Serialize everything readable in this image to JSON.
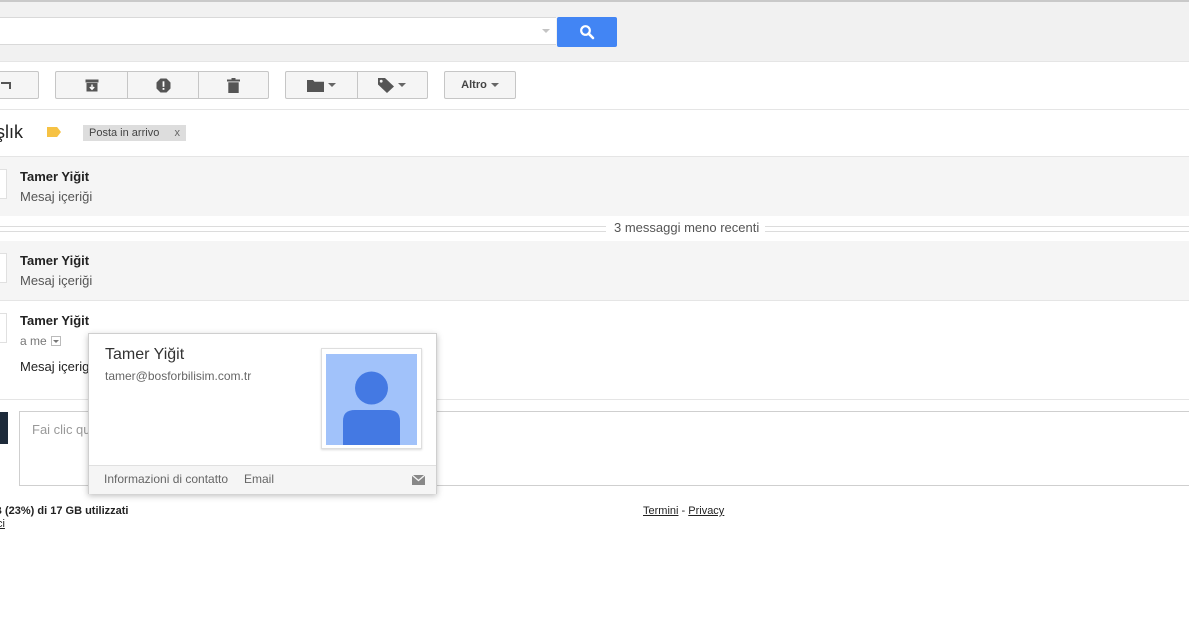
{
  "search": {
    "placeholder": "",
    "value": ""
  },
  "toolbar": {
    "archive_icon": "archive-icon",
    "spam_icon": "report-spam-icon",
    "delete_icon": "trash-icon",
    "move_icon": "folder-icon",
    "labels_icon": "label-tag-icon",
    "more_label": "Altro"
  },
  "thread": {
    "subject": "şlık",
    "inbox_label": "Posta in arrivo",
    "inbox_remove": "x",
    "older_messages": "3 messaggi meno recenti"
  },
  "messages": [
    {
      "sender": "Tamer Yiğit",
      "snippet": "Mesaj içeriği"
    },
    {
      "sender": "Tamer Yiğit",
      "snippet": "Mesaj içeriği"
    },
    {
      "sender": "Tamer Yiğit",
      "recipient": "a me",
      "body": "Mesaj içerig"
    }
  ],
  "reply": {
    "placeholder": "Fai clic qu"
  },
  "footer": {
    "storage": "B (23%) di 17 GB utilizzati",
    "manage": "ci",
    "terms": "Termini",
    "separator": "-",
    "privacy": "Privacy"
  },
  "hovercard": {
    "name": "Tamer Yiğit",
    "email": "tamer@bosforbilisim.com.tr",
    "contact_info": "Informazioni di contatto",
    "email_link": "Email"
  },
  "colors": {
    "accent": "#4285f4",
    "label_yellow": "#f6c244",
    "avatar_bg": "#a1c2fa",
    "avatar_fg": "#4479e3"
  }
}
